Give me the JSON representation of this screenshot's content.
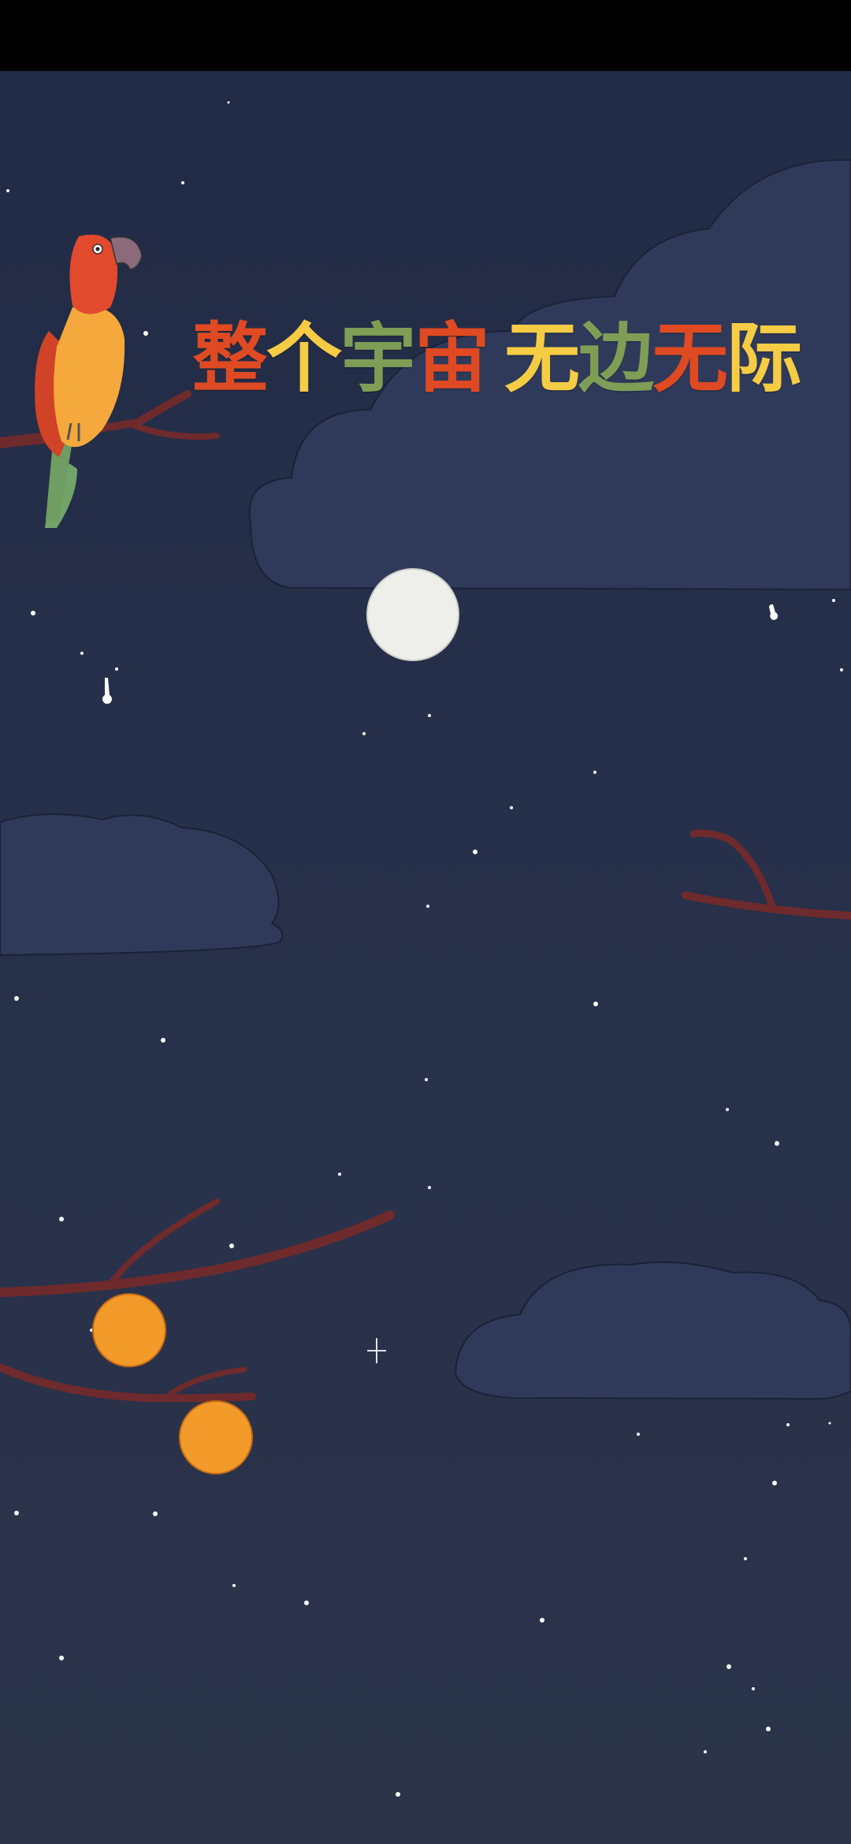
{
  "title": {
    "chars": [
      {
        "text": "整",
        "color": "#df4a22"
      },
      {
        "text": "个",
        "color": "#f5cc44"
      },
      {
        "text": "宇",
        "color": "#7f9e55"
      },
      {
        "text": "宙",
        "color": "#df4a22"
      },
      {
        "text": "无",
        "color": "#f5cc44"
      },
      {
        "text": "边",
        "color": "#7f9e55"
      },
      {
        "text": "无",
        "color": "#df4a22"
      },
      {
        "text": "际",
        "color": "#f5cc44"
      }
    ]
  },
  "colors": {
    "sky": "#252e46",
    "cloud": "#2f3a5a",
    "cloud_outline": "#1b2237",
    "branch": "#6e2a2c",
    "moon": "#eeeeea",
    "fruit": "#f29a2a",
    "star": "#ffffff"
  },
  "icons": [
    "parrot-icon",
    "moon-icon",
    "cloud-icon",
    "branch-icon",
    "fruit-icon",
    "star-icon"
  ]
}
